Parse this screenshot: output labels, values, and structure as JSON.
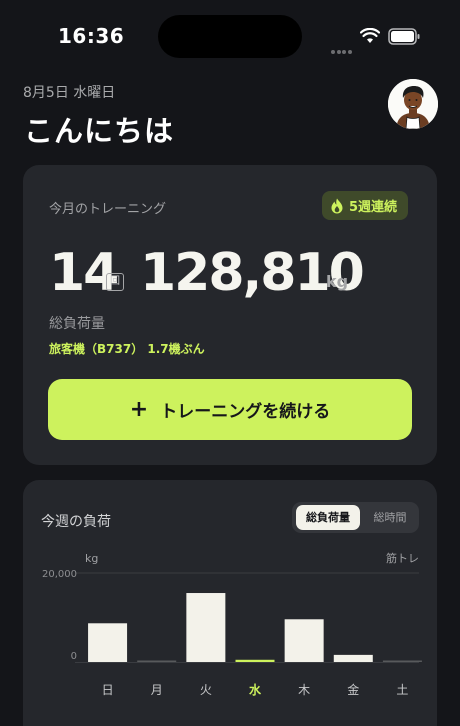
{
  "status_bar": {
    "time": "16:36"
  },
  "header": {
    "date": "8月5日 水曜日",
    "greeting": "こんにちは"
  },
  "monthly_card": {
    "label": "今月のトレーニング",
    "streak": "5週連続",
    "session_count": "14",
    "session_unit": "回",
    "total_load": "128,810",
    "load_unit": "kg",
    "load_label": "総負荷量",
    "comparison": "旅客機（B737） 1.7機ぶん",
    "cta_label": "トレーニングを続ける"
  },
  "weekly_card": {
    "title": "今週の負荷",
    "segments": [
      "総負荷量",
      "総時間"
    ],
    "selected_segment": "総負荷量",
    "unit_label": "kg",
    "right_label": "筋トレ",
    "today": "水"
  },
  "chart_data": {
    "type": "bar",
    "categories": [
      "日",
      "月",
      "火",
      "水",
      "木",
      "金",
      "土"
    ],
    "values": [
      8700,
      300,
      15500,
      500,
      9600,
      1600,
      200
    ],
    "ylim": [
      0,
      20000
    ],
    "yticks": [
      "20,000",
      "0"
    ],
    "ylabel": "kg",
    "highlight_category": "水",
    "grid": true
  },
  "colors": {
    "accent": "#cdf25d",
    "background": "#141519",
    "card": "#25272c",
    "bar": "#f3f2ea",
    "bar_today": "#cdf25d"
  }
}
